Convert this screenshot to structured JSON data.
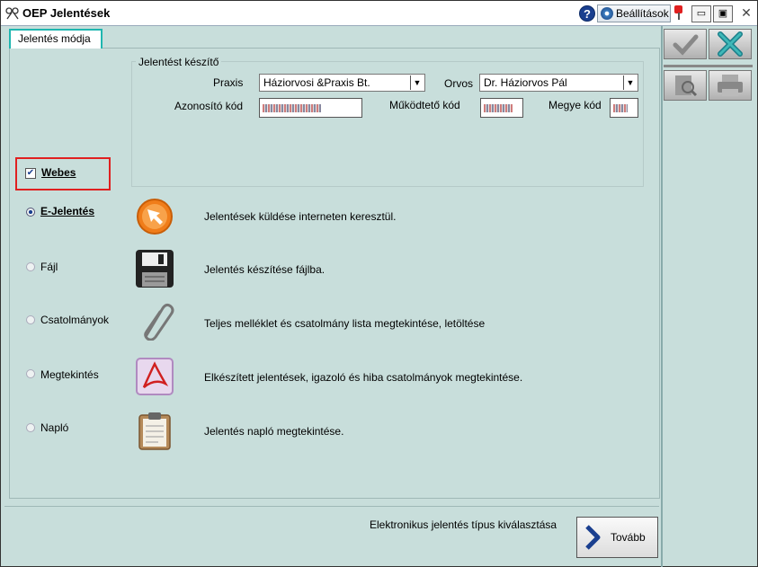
{
  "window": {
    "title": "OEP Jelentések",
    "help_label": "?",
    "settings_label": "Beállítások",
    "minimize_label": "▭",
    "maximize_label": "▣",
    "close_label": "✕"
  },
  "tab": {
    "label": "Jelentés módja"
  },
  "reporter": {
    "legend": "Jelentést készítő",
    "praxis_label": "Praxis",
    "praxis_value": "Háziorvosi &Praxis Bt.",
    "orvos_label": "Orvos",
    "orvos_value": "Dr. Háziorvos Pál",
    "azonosito_label": "Azonosító kód",
    "mukodteto_label": "Működtető kód",
    "megye_label": "Megye kód"
  },
  "webes": {
    "label": "Webes",
    "checked": true
  },
  "options": [
    {
      "label": "E-Jelentés",
      "desc": "Jelentések küldése interneten keresztül.",
      "selected": true,
      "icon": "send-icon"
    },
    {
      "label": "Fájl",
      "desc": "Jelentés készítése fájlba.",
      "selected": false,
      "icon": "floppy-disk-icon"
    },
    {
      "label": "Csatolmányok",
      "desc": "Teljes melléklet és csatolmány lista megtekintése, letöltése",
      "selected": false,
      "icon": "paperclip-icon"
    },
    {
      "label": "Megtekintés",
      "desc": "Elkészített jelentések, igazoló és hiba csatolmányok megtekintése.",
      "selected": false,
      "icon": "pdf-icon"
    },
    {
      "label": "Napló",
      "desc": "Jelentés napló megtekintése.",
      "selected": false,
      "icon": "clipboard-icon"
    }
  ],
  "status": {
    "text": "Elektronikus jelentés típus kiválasztása"
  },
  "next_button": {
    "label": "Tovább"
  },
  "colors": {
    "background": "#c8dedb",
    "tab_border": "#1fb6b0",
    "highlight": "#e02020",
    "accent": "#1a3f8f"
  }
}
